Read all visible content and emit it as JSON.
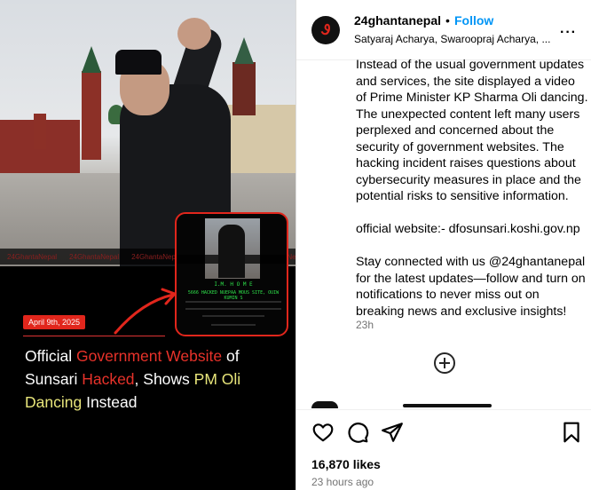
{
  "media": {
    "watermark": "24GhantaNepal",
    "inset": {
      "headline": "I.M. H O M E",
      "subline": "5666 HACKED NUEPAA MOUS SITE, OUIW KUMIN S"
    },
    "date_badge": "April 9th, 2025",
    "headline_parts": [
      {
        "text": "Official ",
        "color": "white"
      },
      {
        "text": "Government Website",
        "color": "red"
      },
      {
        "text": " of Sunsari ",
        "color": "white"
      },
      {
        "text": "Hacked",
        "color": "red"
      },
      {
        "text": ", Shows ",
        "color": "white"
      },
      {
        "text": "PM Oli Dancing",
        "color": "yellow"
      },
      {
        "text": " Instead",
        "color": "white"
      }
    ]
  },
  "post": {
    "username": "24ghantanepal",
    "separator": "•",
    "follow_label": "Follow",
    "collaborators": "Satyaraj Acharya, Swaroopraj Acharya, ...",
    "more_icon": "more-horizontal-icon",
    "caption": [
      "Instead of the usual government updates and services, the site displayed a video of Prime Minister KP Sharma Oli dancing. The unexpected content left many users perplexed and concerned about the security of government websites. The hacking incident raises questions about cybersecurity measures in place and the potential risks to sensitive information.",
      "official website:- dfosunsari.koshi.gov.np",
      "Stay connected with us @24ghantanepal for the latest updates—follow and turn on notifications to never miss out on breaking news and exclusive insights!"
    ],
    "caption_age": "23h",
    "likes": "16,870 likes",
    "posted": "23 hours ago"
  },
  "colors": {
    "follow_blue": "#0095f6",
    "brand_red": "#e1261c",
    "headline_yellow": "#e8e57a",
    "muted_gray": "#737373"
  }
}
